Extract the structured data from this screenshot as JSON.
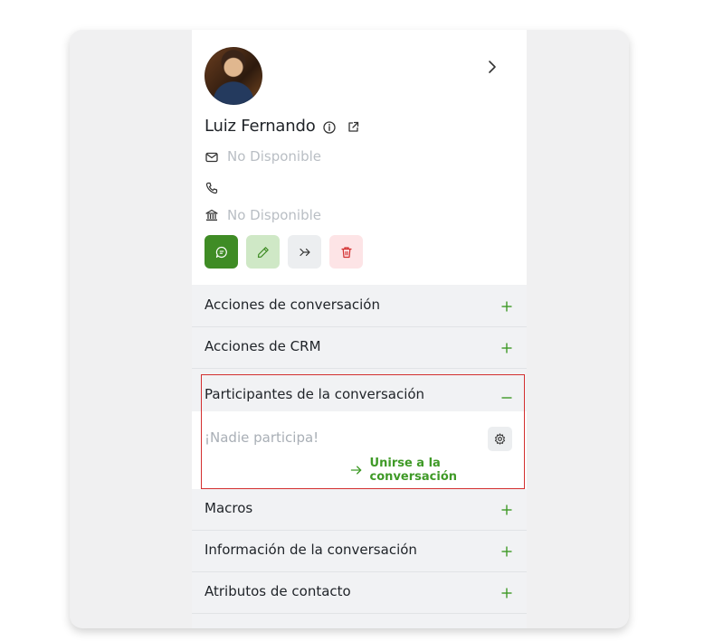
{
  "contact": {
    "name": "Luiz Fernando",
    "email": "No Disponible",
    "phone": "",
    "company": "No Disponible"
  },
  "actions": {
    "chat": "chat-icon",
    "edit": "pencil-icon",
    "forward": "forward-icon",
    "delete": "trash-icon"
  },
  "sections": {
    "conversation_actions": "Acciones de conversación",
    "crm_actions": "Acciones de CRM",
    "participants": "Participantes de la conversación",
    "macros": "Macros",
    "conversation_info": "Información de la conversación",
    "contact_attributes": "Atributos de contacto"
  },
  "participants": {
    "empty_text": "¡Nadie participa!",
    "join_label": "Unirse a la conversación"
  },
  "colors": {
    "accent_green": "#3f8c25",
    "join_green": "#3f9a27",
    "danger_red": "#d32f2f",
    "highlight_border": "#d32f2f"
  }
}
